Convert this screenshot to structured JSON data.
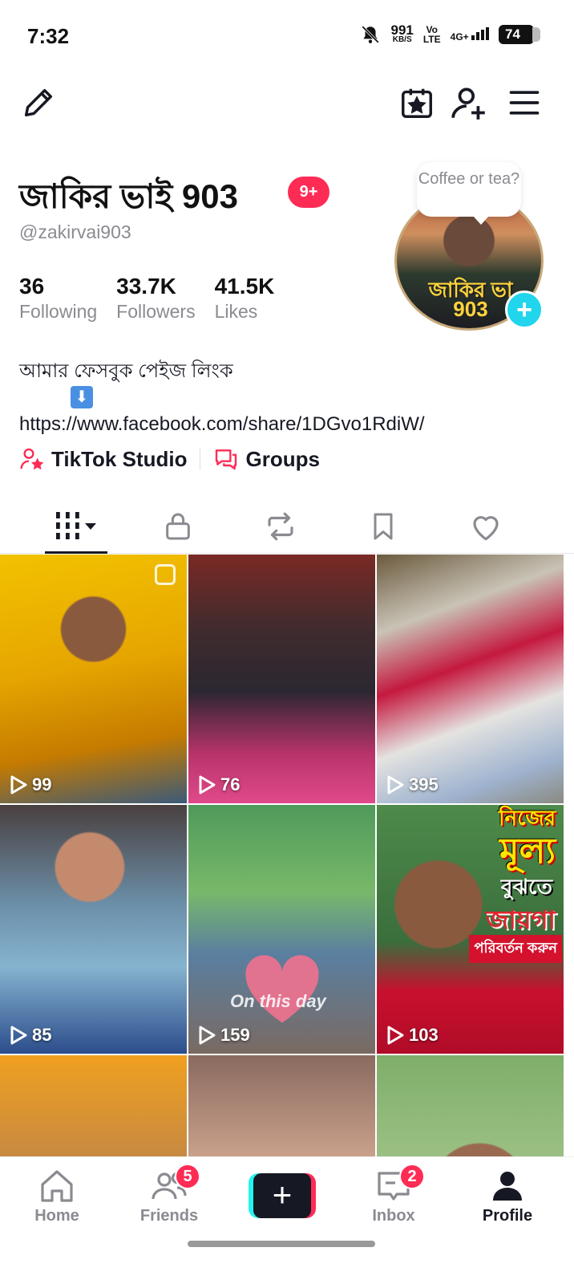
{
  "status_bar": {
    "time": "7:32",
    "net_speed": "991",
    "net_unit": "KB/S",
    "volte": "Vo\nLTE",
    "signal": "4G+",
    "battery": "74"
  },
  "profile": {
    "display_name": "জাকির ভাই 903",
    "notification_badge": "9+",
    "handle": "@zakirvai903",
    "stats": [
      {
        "value": "36",
        "label": "Following"
      },
      {
        "value": "33.7K",
        "label": "Followers"
      },
      {
        "value": "41.5K",
        "label": "Likes"
      }
    ],
    "avatar_bubble": "Coffee or tea?",
    "avatar_logo_line1": "জাকির ভা",
    "avatar_logo_line2": "903",
    "bio_line1": "আমার ফেসবুক পেইজ লিংক",
    "bio_arrow": "⬇",
    "bio_link": "https://www.facebook.com/share/1DGvo1RdiW/"
  },
  "quick_links": {
    "studio": "TikTok Studio",
    "groups": "Groups"
  },
  "colors": {
    "accent": "#fe2c55",
    "cyan": "#25f4ee",
    "text": "#161823",
    "muted": "#8a8b91"
  },
  "videos": [
    {
      "views": "99"
    },
    {
      "views": "76"
    },
    {
      "views": "395"
    },
    {
      "views": "85"
    },
    {
      "views": "159",
      "overlay_text": "On this day"
    },
    {
      "views": "103",
      "overlay_line1": "নিজের",
      "overlay_line2": "মূল্য",
      "overlay_line3": "বুঝতে",
      "overlay_line4": "জায়গা",
      "overlay_line5": "পরিবর্তন করুন"
    },
    {
      "views": ""
    },
    {
      "views": ""
    },
    {
      "views": ""
    }
  ],
  "bottom_nav": {
    "home": "Home",
    "friends": "Friends",
    "friends_badge": "5",
    "create": "+",
    "inbox": "Inbox",
    "inbox_badge": "2",
    "profile": "Profile"
  }
}
